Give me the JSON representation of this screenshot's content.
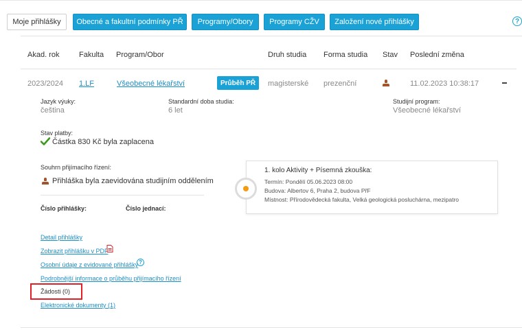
{
  "tabs": [
    {
      "label": "Moje přihlášky"
    },
    {
      "label": "Obecné a fakultní podmínky PŘ"
    },
    {
      "label": "Programy/Obory"
    },
    {
      "label": "Programy CŽV"
    },
    {
      "label": "Založení nové přihlášky"
    }
  ],
  "help_icon": "?",
  "table": {
    "headers": [
      "Akad. rok",
      "Fakulta",
      "Program/Obor",
      "Druh studia",
      "Forma studia",
      "Stav",
      "Poslední změna"
    ],
    "row": {
      "year": "2023/2024",
      "faculty": "1.LF",
      "program": "Všeobecné lékařství",
      "badge": "Průběh PŘ",
      "type": "magisterské",
      "form": "prezenční",
      "status_icon": "person-icon",
      "last_change": "11.02.2023 10:38:17",
      "collapse": "−"
    }
  },
  "detail": {
    "language_label": "Jazyk výuky:",
    "language_value": "čeština",
    "duration_label": "Standardní doba studia:",
    "duration_value": "6 let",
    "program_label": "Studijní program:",
    "program_value": "Všeobecné lékařství",
    "payment_label": "Stav platby:",
    "payment_value": "Částka 830 Kč byla zaplacena",
    "summary_label": "Souhrn přijímacího řízení:",
    "summary_value": "Přihláška byla zaevidována studijním oddělením",
    "app_number_label": "Číslo přihlášky:",
    "ref_number_label": "Číslo jednací:"
  },
  "exam": {
    "title": "1. kolo Aktivity + Písemná zkouška:",
    "term": "Termín: Pondělí 05.06.2023 08:00",
    "building": "Budova: Albertov 6, Praha 2, budova PřF",
    "room": "Místnost: Přírodovědecká fakulta, Velká geologická posluchárna, mezipatro"
  },
  "links": {
    "detail": "Detail přihlášky",
    "pdf": "Zobrazit přihlášku v PDF",
    "personal": "Osobní údaje z evidované přihlášky",
    "progress": "Podrobnější informace o průběhu přijímacího řízení",
    "requests": "Žádosti (0)",
    "documents": "Elektronické dokumenty (1)"
  },
  "colors": {
    "accent": "#1aa1d6",
    "link": "#1a8fc6",
    "highlight": "#e01f26",
    "check": "#3a9a1e",
    "timeline_dot": "#f39c12"
  }
}
